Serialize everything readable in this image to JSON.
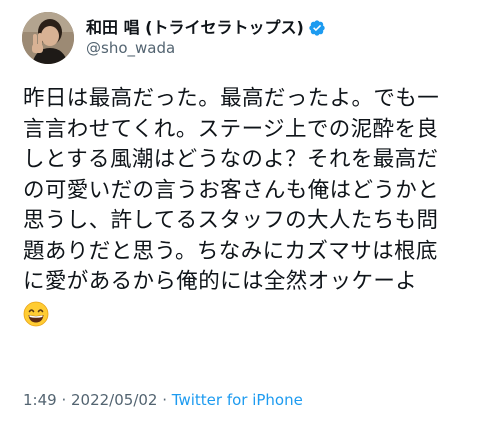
{
  "user": {
    "display_name": "和田 唱 (トライセラトップス)",
    "handle": "@sho_wada",
    "verified_color": "#1d9bf0"
  },
  "tweet": {
    "lines": [
      "昨日は最高だった。最高だったよ。でも一",
      "言言わせてくれ。ステージ上での泥酔を良",
      "しとする風潮はどうなのよ？それを最高だ",
      "の可愛いだの言うお客さんも俺はどうかと",
      "思うし、許してるスタッフの大人たちも問",
      "題ありだと思う。ちなみにカズマサは根底",
      "に愛があるから俺的には全然オッケーよ"
    ],
    "emoji": "grinning-face-with-smiling-eyes"
  },
  "meta": {
    "time": "1:49",
    "separator": " · ",
    "date": "2022/05/02",
    "source": "Twitter for iPhone"
  }
}
